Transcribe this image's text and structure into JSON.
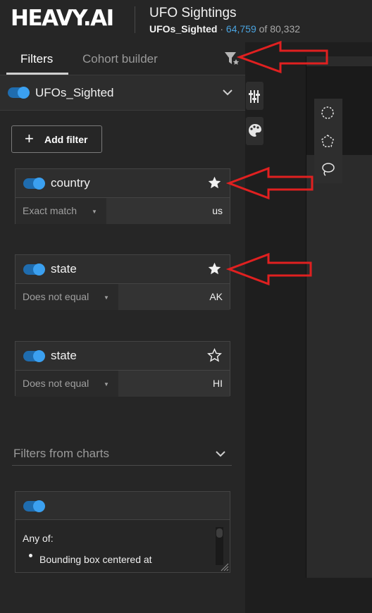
{
  "header": {
    "logo_text": "HEAVY.AI",
    "title": "UFO Sightings",
    "dataset": "UFOs_Sighted",
    "separator": "·",
    "filtered_count": "64,759",
    "of_text": "of",
    "total_count": "80,332"
  },
  "tabs": {
    "filters": "Filters",
    "cohort_builder": "Cohort builder"
  },
  "dataset_row": {
    "name": "UFOs_Sighted",
    "enabled": true
  },
  "add_filter": {
    "label": "Add filter"
  },
  "filters": [
    {
      "field": "country",
      "operator": "Exact match",
      "value": "us",
      "starred": true,
      "enabled": true
    },
    {
      "field": "state",
      "operator": "Does not equal",
      "value": "AK",
      "starred": true,
      "enabled": true
    },
    {
      "field": "state",
      "operator": "Does not equal",
      "value": "HI",
      "starred": false,
      "enabled": true
    }
  ],
  "filters_from_charts": {
    "label": "Filters from charts",
    "card": {
      "enabled": true,
      "any_of": "Any of:",
      "item": "Bounding box centered at"
    }
  },
  "icons": {
    "funnel": "funnel-star-icon",
    "chevron": "chevron-down-icon",
    "star_filled": "star-filled-icon",
    "star_outline": "star-outline-icon",
    "sliders": "sliders-icon",
    "palette": "palette-icon",
    "draw_circle": "circle-select-icon",
    "draw_polygon": "polygon-select-icon",
    "draw_lasso": "lasso-select-icon"
  },
  "colors": {
    "accent": "#3ba0f0",
    "toggle_track": "#1f6cae",
    "annotation_arrow": "#e02020"
  }
}
